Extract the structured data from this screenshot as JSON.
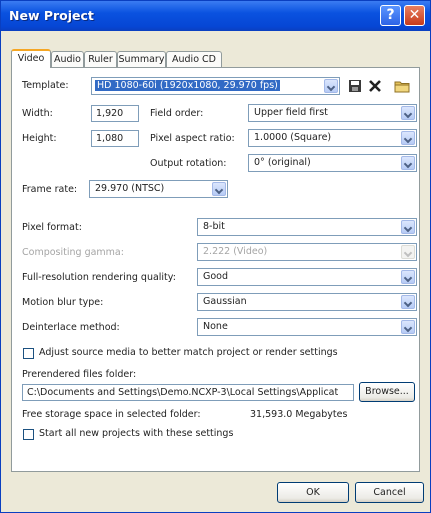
{
  "window": {
    "title": "New Project",
    "help_glyph": "?",
    "close_glyph": "✕"
  },
  "tabs": [
    "Video",
    "Audio",
    "Ruler",
    "Summary",
    "Audio CD"
  ],
  "template": {
    "label": "Template:",
    "value": "HD 1080-60i (1920x1080, 29.970 fps)"
  },
  "width": {
    "label": "Width:",
    "value": "1,920"
  },
  "height": {
    "label": "Height:",
    "value": "1,080"
  },
  "field_order": {
    "label": "Field order:",
    "value": "Upper field first"
  },
  "pixel_aspect": {
    "label": "Pixel aspect ratio:",
    "value": "1.0000 (Square)"
  },
  "output_rotation": {
    "label": "Output rotation:",
    "value": "0° (original)"
  },
  "frame_rate": {
    "label": "Frame rate:",
    "value": "29.970 (NTSC)"
  },
  "pixel_format": {
    "label": "Pixel format:",
    "value": "8-bit"
  },
  "compositing_gamma": {
    "label": "Compositing gamma:",
    "value": "2.222 (Video)"
  },
  "render_quality": {
    "label": "Full-resolution rendering quality:",
    "value": "Good"
  },
  "motion_blur": {
    "label": "Motion blur type:",
    "value": "Gaussian"
  },
  "deinterlace": {
    "label": "Deinterlace method:",
    "value": "None"
  },
  "adjust_source": {
    "label": "Adjust source media to better match project or render settings",
    "checked": false
  },
  "prerendered": {
    "label": "Prerendered files folder:",
    "path": "C:\\Documents and Settings\\Demo.NCXP-3\\Local Settings\\Applicat",
    "browse_label": "Browse..."
  },
  "free_space": {
    "label": "Free storage space in selected folder:",
    "value": "31,593.0 Megabytes"
  },
  "start_all": {
    "label": "Start all new projects with these settings",
    "checked": false
  },
  "buttons": {
    "ok": "OK",
    "cancel": "Cancel"
  },
  "colors": {
    "title_bar": "#0a52e0",
    "tab_highlight": "#f5a623",
    "selection": "#316ac5"
  }
}
